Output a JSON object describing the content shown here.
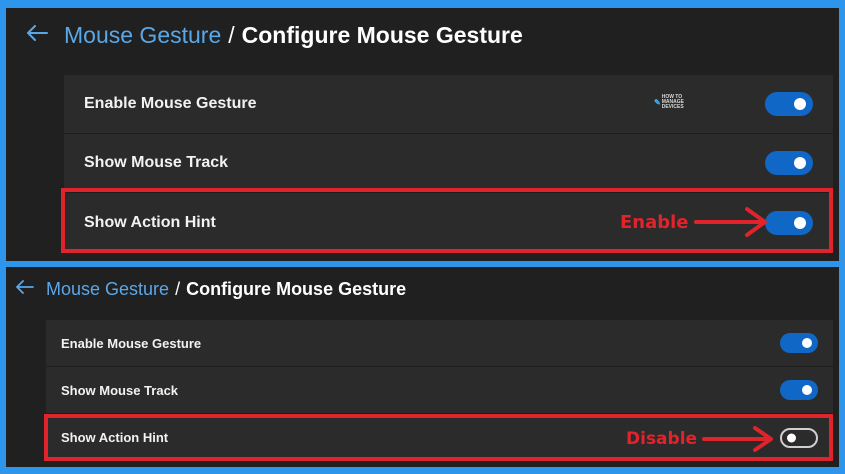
{
  "top": {
    "breadcrumb": {
      "link": "Mouse Gesture",
      "separator": "/",
      "current": "Configure Mouse Gesture"
    },
    "rows": [
      {
        "label": "Enable Mouse Gesture",
        "toggle_on": true
      },
      {
        "label": "Show Mouse Track",
        "toggle_on": true
      },
      {
        "label": "Show Action Hint",
        "toggle_on": true
      }
    ],
    "annotation": "Enable",
    "watermark": {
      "glyph": "✎",
      "line1": "HOW TO",
      "line2": "MANAGE",
      "line3": "DEVICES"
    }
  },
  "bottom": {
    "breadcrumb": {
      "link": "Mouse Gesture",
      "separator": "/",
      "current": "Configure Mouse Gesture"
    },
    "rows": [
      {
        "label": "Enable Mouse Gesture",
        "toggle_on": true
      },
      {
        "label": "Show Mouse Track",
        "toggle_on": true
      },
      {
        "label": "Show Action Hint",
        "toggle_on": false
      }
    ],
    "annotation": "Disable"
  },
  "colors": {
    "accent": "#1067c5",
    "link": "#5aa7e8",
    "highlight": "#e0242b",
    "frame": "#2d96ec"
  }
}
